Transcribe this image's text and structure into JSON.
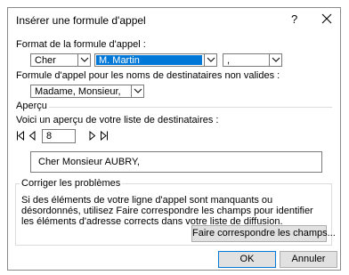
{
  "dialog": {
    "title": "Insérer une formule d'appel",
    "help_glyph": "?",
    "close_glyph": "✕"
  },
  "format": {
    "label": "Format de la formule d'appel :",
    "salutation_value": "Cher",
    "name_value": "M. Martin",
    "punct_value": ","
  },
  "invalid": {
    "label": "Formule d'appel pour les noms de destinataires non valides :",
    "value": "Madame, Monsieur,"
  },
  "apercu": {
    "section_label": "Aperçu",
    "list_label": "Voici un aperçu de votre liste de destinataires :",
    "record_number": "8",
    "preview_text": "Cher Monsieur AUBRY,"
  },
  "corriger": {
    "legend": "Corriger les problèmes",
    "text": "Si des éléments de votre ligne d'appel sont manquants ou désordonnés, utilisez Faire correspondre les champs pour identifier les éléments d'adresse corrects dans votre liste de diffusion.",
    "match_button": "Faire correspondre les champs..."
  },
  "footer": {
    "ok_label": "OK",
    "cancel_label": "Annuler"
  },
  "colors": {
    "selection": "#0078d7",
    "button_face": "#e1e1e1"
  }
}
